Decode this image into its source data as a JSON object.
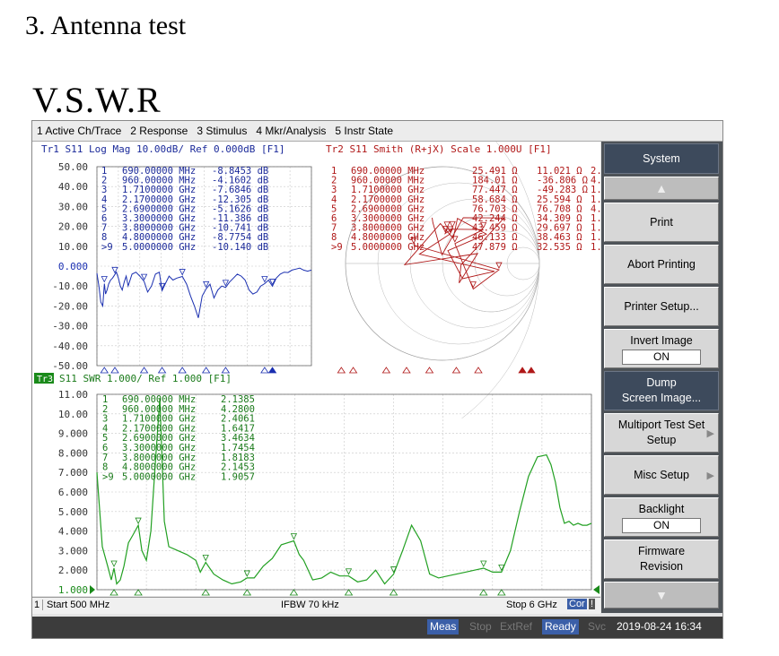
{
  "doc": {
    "heading": "3. Antenna test",
    "subheading": "V.S.W.R"
  },
  "menu": [
    "1 Active Ch/Trace",
    "2 Response",
    "3 Stimulus",
    "4 Mkr/Analysis",
    "5 Instr State"
  ],
  "softkeys": {
    "system": "System",
    "print": "Print",
    "abort_printing": "Abort Printing",
    "printer_setup": "Printer Setup...",
    "invert_image": "Invert Image",
    "invert_image_value": "ON",
    "dump_1": "Dump",
    "dump_2": "Screen Image...",
    "multiport_1": "Multiport Test Set",
    "multiport_2": "Setup",
    "misc_setup": "Misc Setup",
    "backlight": "Backlight",
    "backlight_value": "ON",
    "firmware_1": "Firmware",
    "firmware_2": "Revision"
  },
  "channel_bar": {
    "ch": "1",
    "start": "Start 500 MHz",
    "ifbw": "IFBW 70 kHz",
    "stop": "Stop 6 GHz",
    "cor": "Cor",
    "excl": "!"
  },
  "status": {
    "meas": "Meas",
    "stop": "Stop",
    "extref": "ExtRef",
    "ready": "Ready",
    "svc": "Svc",
    "datetime": "2019-08-24 16:34"
  },
  "trace1": {
    "header": "Tr1 S11 Log Mag 10.00dB/ Ref 0.000dB [F1]",
    "ref_label": "0.000",
    "yticks": [
      "50.00",
      "40.00",
      "30.00",
      "20.00",
      "10.00",
      "0.000",
      "-10.00",
      "-20.00",
      "-30.00",
      "-40.00",
      "-50.00"
    ],
    "markers": [
      {
        "n": "1",
        "freq": "690.00000 MHz",
        "val": "-8.8453 dB"
      },
      {
        "n": "2",
        "freq": "960.00000 MHz",
        "val": "-4.1602 dB"
      },
      {
        "n": "3",
        "freq": "1.7100000 GHz",
        "val": "-7.6846 dB"
      },
      {
        "n": "4",
        "freq": "2.1700000 GHz",
        "val": "-12.305 dB"
      },
      {
        "n": "5",
        "freq": "2.6900000 GHz",
        "val": "-5.1626 dB"
      },
      {
        "n": "6",
        "freq": "3.3000000 GHz",
        "val": "-11.386 dB"
      },
      {
        "n": "7",
        "freq": "3.8000000 GHz",
        "val": "-10.741 dB"
      },
      {
        "n": "8",
        "freq": "4.8000000 GHz",
        "val": "-8.7754 dB"
      },
      {
        "n": ">9",
        "freq": "5.0000000 GHz",
        "val": "-10.140 dB"
      }
    ]
  },
  "trace2": {
    "header": "Tr2 S11 Smith (R+jX) Scale 1.000U [F1]",
    "markers": [
      {
        "n": "1",
        "freq": "690.00000 MHz",
        "r": "25.491 Ω",
        "x": "11.021 Ω",
        "l": "2."
      },
      {
        "n": "2",
        "freq": "960.00000 MHz",
        "r": "184.01 Ω",
        "x": "-36.806 Ω",
        "l": "4."
      },
      {
        "n": "3",
        "freq": "1.7100000 GHz",
        "r": "77.447 Ω",
        "x": "-49.283 Ω",
        "l": "1."
      },
      {
        "n": "4",
        "freq": "2.1700000 GHz",
        "r": "58.684 Ω",
        "x": "25.594 Ω",
        "l": "1."
      },
      {
        "n": "5",
        "freq": "2.6900000 GHz",
        "r": "76.703 Ω",
        "x": "76.708 Ω",
        "l": "4."
      },
      {
        "n": "6",
        "freq": "3.3000000 GHz",
        "r": "42.244 Ω",
        "x": "34.309 Ω",
        "l": "1."
      },
      {
        "n": "7",
        "freq": "3.8000000 GHz",
        "r": "43.459 Ω",
        "x": "29.697 Ω",
        "l": "1."
      },
      {
        "n": "8",
        "freq": "4.8000000 GHz",
        "r": "46.133 Ω",
        "x": "38.463 Ω",
        "l": "1."
      },
      {
        "n": ">9",
        "freq": "5.0000000 GHz",
        "r": "47.879 Ω",
        "x": "32.535 Ω",
        "l": "1."
      }
    ]
  },
  "trace3": {
    "tag": "Tr3",
    "header": "S11 SWR 1.000/ Ref 1.000 [F1]",
    "yticks": [
      "11.00",
      "10.00",
      "9.000",
      "8.000",
      "7.000",
      "6.000",
      "5.000",
      "4.000",
      "3.000",
      "2.000",
      "1.000"
    ],
    "markers": [
      {
        "n": "1",
        "freq": "690.00000 MHz",
        "val": "2.1385"
      },
      {
        "n": "2",
        "freq": "960.00000 MHz",
        "val": "4.2800"
      },
      {
        "n": "3",
        "freq": "1.7100000 GHz",
        "val": "2.4061"
      },
      {
        "n": "4",
        "freq": "2.1700000 GHz",
        "val": "1.6417"
      },
      {
        "n": "5",
        "freq": "2.6900000 GHz",
        "val": "3.4634"
      },
      {
        "n": "6",
        "freq": "3.3000000 GHz",
        "val": "1.7454"
      },
      {
        "n": "7",
        "freq": "3.8000000 GHz",
        "val": "1.8183"
      },
      {
        "n": "8",
        "freq": "4.8000000 GHz",
        "val": "2.1453"
      },
      {
        "n": ">9",
        "freq": "5.0000000 GHz",
        "val": "1.9057"
      }
    ]
  },
  "chart_data": [
    {
      "type": "line",
      "title": "Tr1 S11 Log Mag 10.00dB/ Ref 0.000dB [F1]",
      "xlabel": "",
      "ylabel": "",
      "xlim": [
        500,
        6000
      ],
      "ylim": [
        -50,
        50
      ],
      "series": [
        {
          "name": "S11",
          "x": [
            500,
            550,
            600,
            650,
            690,
            720,
            760,
            800,
            850,
            900,
            960,
            1000,
            1050,
            1100,
            1150,
            1200,
            1250,
            1300,
            1400,
            1500,
            1600,
            1710,
            1800,
            1900,
            2000,
            2100,
            2170,
            2250,
            2350,
            2450,
            2550,
            2690,
            2800,
            2900,
            3000,
            3100,
            3200,
            3300,
            3400,
            3500,
            3600,
            3700,
            3800,
            3900,
            4000,
            4100,
            4200,
            4300,
            4400,
            4500,
            4600,
            4700,
            4800,
            4900,
            5000,
            5100,
            5200,
            5300,
            5400,
            5500,
            5600,
            5700,
            5800,
            5900,
            6000
          ],
          "y": [
            -3.5,
            -10,
            -18,
            -20,
            -8.8,
            -14,
            -12,
            -9,
            -7,
            -6,
            -4.2,
            -3,
            -6,
            -10,
            -12,
            -8,
            -5,
            -10,
            -4,
            -3,
            -5,
            -7.7,
            -13,
            -10,
            -4,
            -3,
            -12.3,
            -9,
            -5,
            -7,
            -6,
            -5.2,
            -9,
            -15,
            -20,
            -26,
            -15,
            -11.4,
            -9,
            -16,
            -12,
            -10,
            -10.7,
            -8,
            -6,
            -4,
            -5,
            -7,
            -12,
            -14,
            -13,
            -10,
            -8.8,
            -7,
            -10.1,
            -6,
            -4,
            -3,
            -3.2,
            -2,
            -1.5,
            -1,
            -2,
            -2.5,
            -2
          ]
        }
      ],
      "markers_x": [
        690,
        960,
        1710,
        2170,
        2690,
        3300,
        3800,
        4800,
        5000
      ]
    },
    {
      "type": "line",
      "title": "Tr3 S11 SWR 1.000/ Ref 1.000 [F1]",
      "xlabel": "",
      "ylabel": "",
      "xlim": [
        500,
        6000
      ],
      "ylim": [
        1,
        11
      ],
      "series": [
        {
          "name": "SWR",
          "x": [
            500,
            560,
            620,
            660,
            690,
            720,
            760,
            800,
            850,
            900,
            960,
            1000,
            1050,
            1100,
            1150,
            1200,
            1250,
            1300,
            1400,
            1500,
            1600,
            1650,
            1710,
            1800,
            1900,
            2000,
            2100,
            2170,
            2250,
            2350,
            2450,
            2550,
            2620,
            2690,
            2750,
            2800,
            2900,
            3000,
            3100,
            3200,
            3300,
            3400,
            3500,
            3600,
            3700,
            3800,
            3900,
            4000,
            4100,
            4200,
            4300,
            4400,
            4500,
            4600,
            4700,
            4800,
            4900,
            5000,
            5100,
            5200,
            5300,
            5400,
            5500,
            5550,
            5600,
            5650,
            5700,
            5750,
            5800,
            5850,
            5900,
            5950,
            6000
          ],
          "y": [
            7.0,
            3.2,
            2.2,
            1.5,
            2.1,
            1.3,
            1.5,
            2.2,
            3.4,
            3.8,
            4.3,
            3.0,
            2.5,
            4.0,
            7.5,
            10.8,
            4.5,
            3.2,
            3.0,
            2.8,
            2.5,
            1.9,
            2.4,
            1.8,
            1.5,
            1.3,
            1.4,
            1.6,
            1.6,
            2.2,
            2.6,
            3.3,
            3.4,
            3.5,
            2.8,
            2.5,
            1.5,
            1.6,
            1.9,
            1.7,
            1.7,
            1.4,
            1.5,
            2.0,
            1.3,
            1.8,
            3.0,
            4.3,
            3.5,
            1.8,
            1.6,
            1.7,
            1.8,
            1.9,
            2.0,
            2.1,
            1.9,
            1.9,
            3.0,
            5.0,
            6.8,
            7.8,
            7.9,
            7.4,
            6.5,
            5.2,
            4.4,
            4.5,
            4.3,
            4.4,
            4.3,
            4.3,
            4.4
          ]
        }
      ],
      "markers_x": [
        690,
        960,
        1710,
        2170,
        2690,
        3300,
        3800,
        4800,
        5000
      ]
    }
  ]
}
